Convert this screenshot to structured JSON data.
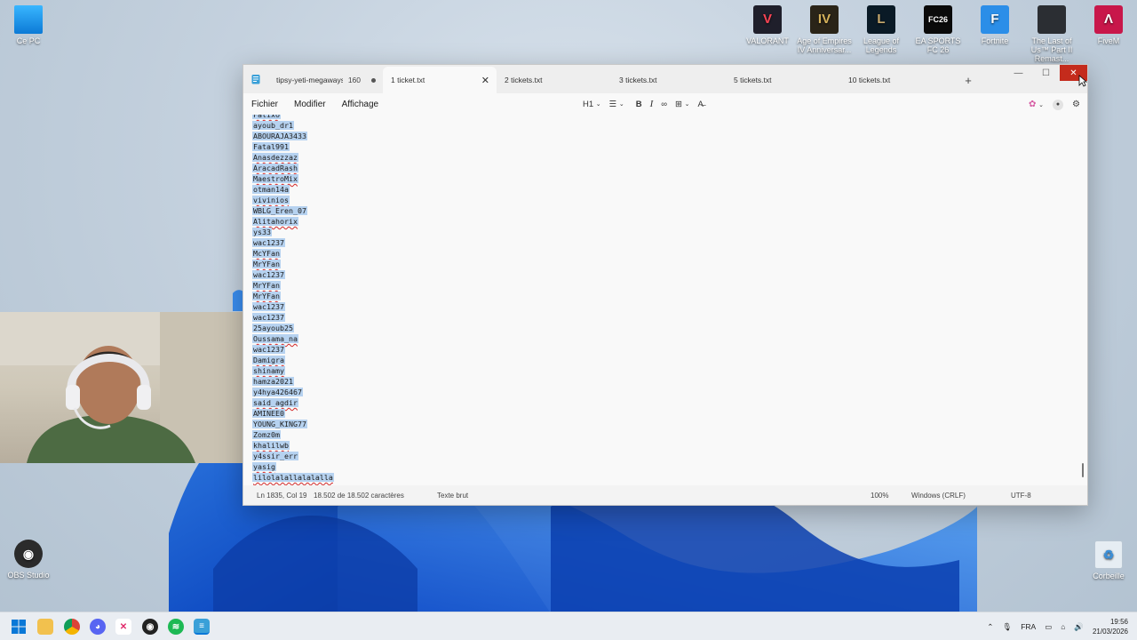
{
  "desktop": {
    "icons_top": [
      {
        "label": "VALORANT",
        "color": "#1f1f2b",
        "glyph": "V",
        "accent": "#fa4454"
      },
      {
        "label": "Age of Empires IV Anniversar...",
        "color": "#2a2418",
        "glyph": "IV",
        "accent": "#d6b25a"
      },
      {
        "label": "League of Legends",
        "color": "#0a1a26",
        "glyph": "L",
        "accent": "#c8aa6e"
      },
      {
        "label": "EA SPORTS FC 26",
        "color": "#0a0a0a",
        "glyph": "FC26",
        "accent": "#ffffff"
      },
      {
        "label": "Fortnite",
        "color": "#2b8ee8",
        "glyph": "F",
        "accent": "#ffffff"
      },
      {
        "label": "The Last of Us™ Part II Remast...",
        "color": "#2b2e33",
        "glyph": "",
        "accent": "#9aa3ad"
      },
      {
        "label": "FiveM",
        "color": "#c8174a",
        "glyph": "Λ",
        "accent": "#ffffff"
      }
    ],
    "icon_pc": "Ce PC",
    "icon_obs": "OBS Studio",
    "icon_bin": "Corbeille"
  },
  "window": {
    "tabs": [
      {
        "label": "tipsy-yeti-megaways",
        "count": "160",
        "dot": true,
        "active": false
      },
      {
        "label": "1 ticket.txt",
        "active": true
      },
      {
        "label": "2 tickets.txt",
        "active": false
      },
      {
        "label": "3 tickets.txt",
        "active": false
      },
      {
        "label": "5 tickets.txt",
        "active": false
      },
      {
        "label": "10 tickets.txt",
        "active": false
      }
    ],
    "menu": [
      "Fichier",
      "Modifier",
      "Affichage"
    ],
    "heading_select": "H1",
    "bold_label": "B",
    "italic_label": "I",
    "lines": [
      {
        "text": "Fatixo",
        "sq": true
      },
      {
        "text": "ayoub_dr1",
        "sq": false
      },
      {
        "text": "ABOURAJA3433",
        "sq": false
      },
      {
        "text": "Fatal991",
        "sq": false
      },
      {
        "text": "Anasdezzaz",
        "sq": true
      },
      {
        "text": "AracadRash",
        "sq": true
      },
      {
        "text": "MaestroMix",
        "sq": true
      },
      {
        "text": "otman14a",
        "sq": false
      },
      {
        "text": "vivinios",
        "sq": true
      },
      {
        "text": "WBLG_Eren_07",
        "sq": false
      },
      {
        "text": "Alitahorix",
        "sq": true
      },
      {
        "text": "ys33",
        "sq": false
      },
      {
        "text": "wac1237",
        "sq": false
      },
      {
        "text": "McYFan",
        "sq": true
      },
      {
        "text": "MrYFan",
        "sq": true
      },
      {
        "text": "wac1237",
        "sq": false
      },
      {
        "text": "MrYFan",
        "sq": true
      },
      {
        "text": "MrYFan",
        "sq": true
      },
      {
        "text": "wac1237",
        "sq": false
      },
      {
        "text": "wac1237",
        "sq": false
      },
      {
        "text": "25ayoub25",
        "sq": false
      },
      {
        "text": "Oussama_na",
        "sq": true
      },
      {
        "text": "wac1237",
        "sq": false
      },
      {
        "text": "Damigra",
        "sq": true
      },
      {
        "text": "shinamy",
        "sq": true
      },
      {
        "text": "hamza2021",
        "sq": false
      },
      {
        "text": "y4hya426467",
        "sq": false
      },
      {
        "text": "said_agdir",
        "sq": true
      },
      {
        "text": "AMINEE0",
        "sq": false
      },
      {
        "text": "YOUNG_KING77",
        "sq": false
      },
      {
        "text": "Zomz0m",
        "sq": false
      },
      {
        "text": "khalilwb",
        "sq": true
      },
      {
        "text": "y4ssir_err",
        "sq": false
      },
      {
        "text": "yasig",
        "sq": true
      },
      {
        "text": "lilolalallalalalla",
        "sq": true
      }
    ],
    "status": {
      "position": "Ln 1835, Col 19",
      "chars": "18.502 de 18.502 caractères",
      "format": "Texte brut",
      "zoom": "100%",
      "eol": "Windows (CRLF)",
      "encoding": "UTF-8"
    }
  },
  "taskbar": {
    "lang": "FRA",
    "time": "19:56",
    "date": "21/03/2026"
  }
}
